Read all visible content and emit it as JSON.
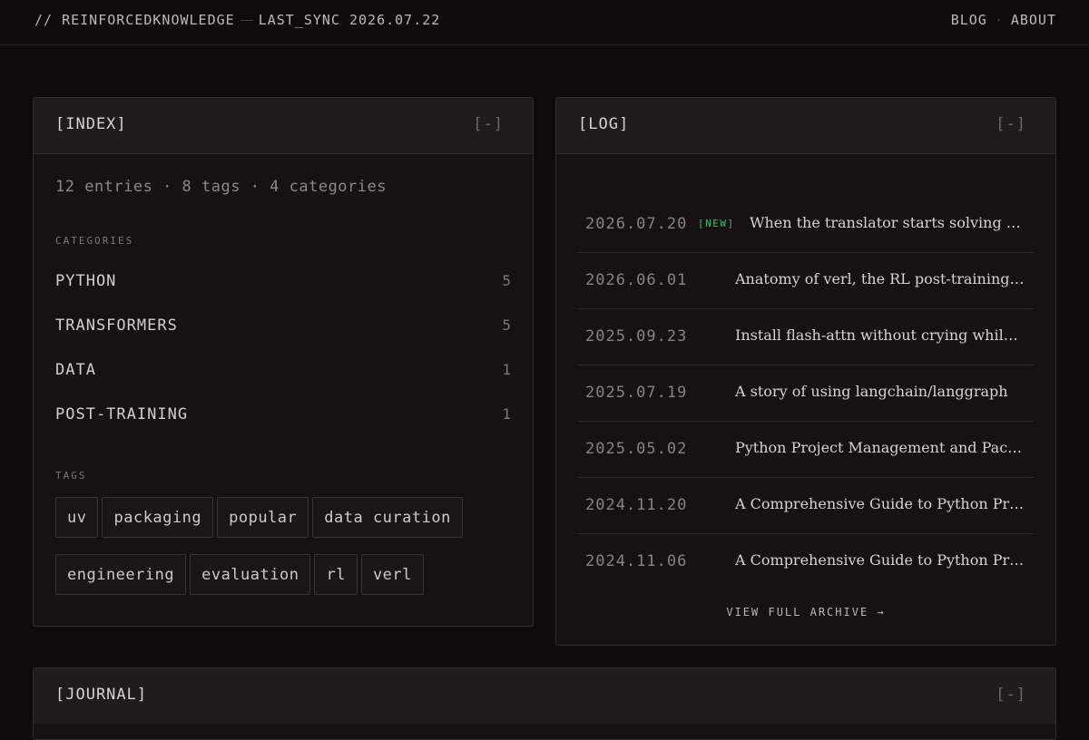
{
  "header": {
    "brand": "// REINFORCEDKNOWLEDGE",
    "sync": "LAST_SYNC 2026.07.22",
    "nav": [
      {
        "label": "BLOG"
      },
      {
        "label": "ABOUT"
      }
    ],
    "nav_separator": "·"
  },
  "index": {
    "title": "[INDEX]",
    "toggle": "[-]",
    "stats": "12 entries · 8 tags · 4 categories",
    "categories_label": "CATEGORIES",
    "categories": [
      {
        "name": "PYTHON",
        "count": "5"
      },
      {
        "name": "TRANSFORMERS",
        "count": "5"
      },
      {
        "name": "DATA",
        "count": "1"
      },
      {
        "name": "POST-TRAINING",
        "count": "1"
      }
    ],
    "tags_label": "TAGS",
    "tags": [
      "uv",
      "packaging",
      "popular",
      "data curation",
      "engineering",
      "evaluation",
      "rl",
      "verl"
    ]
  },
  "log": {
    "title": "[LOG]",
    "toggle": "[-]",
    "new_badge": "[NEW]",
    "entries": [
      {
        "date": "2026.07.20",
        "title": "When the translator starts solving the problem",
        "is_new": true
      },
      {
        "date": "2026.06.01",
        "title": "Anatomy of verl, the RL post-training framework",
        "is_new": false
      },
      {
        "date": "2025.09.23",
        "title": "Install flash-attn without crying while waiting",
        "is_new": false
      },
      {
        "date": "2025.07.19",
        "title": "A story of using langchain/langgraph",
        "is_new": false
      },
      {
        "date": "2025.05.02",
        "title": "Python Project Management and Packaging",
        "is_new": false
      },
      {
        "date": "2024.11.20",
        "title": "A Comprehensive Guide to Python Project Management",
        "is_new": false
      },
      {
        "date": "2024.11.06",
        "title": "A Comprehensive Guide to Python Project Management",
        "is_new": false
      }
    ],
    "archive_link": "VIEW FULL ARCHIVE →"
  },
  "journal": {
    "title": "[JOURNAL]",
    "toggle": "[-]"
  }
}
